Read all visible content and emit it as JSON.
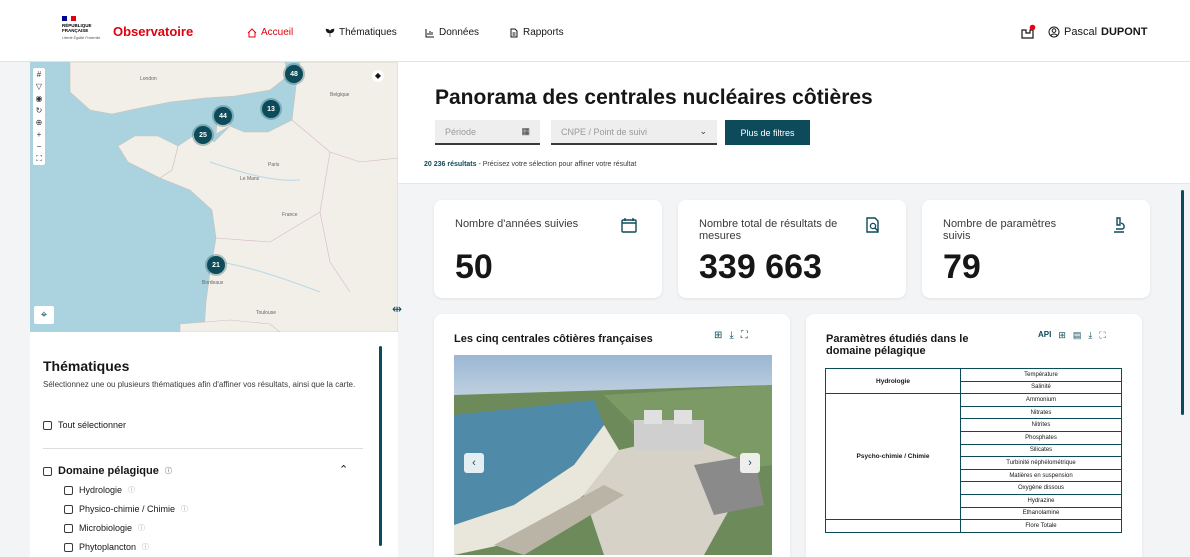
{
  "header": {
    "logo_text_1": "RÉPUBLIQUE",
    "logo_text_2": "FRANÇAISE",
    "logo_motto": "Liberté Égalité Fraternité",
    "brand": "Observatoire",
    "nav": [
      {
        "label": "Accueil",
        "icon": "home-icon",
        "active": true
      },
      {
        "label": "Thématiques",
        "icon": "plant-icon",
        "active": false
      },
      {
        "label": "Données",
        "icon": "chart-icon",
        "active": false
      },
      {
        "label": "Rapports",
        "icon": "document-icon",
        "active": false
      }
    ],
    "notification_icon": "inbox-notification-icon",
    "user_first": "Pascal",
    "user_last": "DUPONT"
  },
  "map": {
    "clusters": [
      {
        "label": "48"
      },
      {
        "label": "13"
      },
      {
        "label": "44"
      },
      {
        "label": "25"
      },
      {
        "label": "21"
      }
    ],
    "place_labels": [
      "London",
      "Belgique",
      "Paris",
      "France",
      "Bordeaux",
      "Toulouse",
      "Le Mans"
    ]
  },
  "thematiques": {
    "title": "Thématiques",
    "description": "Sélectionnez une ou plusieurs thématiques afin d'affiner vos résultats, ainsi que la carte.",
    "select_all": "Tout sélectionner",
    "group": "Domaine pélagique",
    "items": [
      "Hydrologie",
      "Physico-chimie / Chimie",
      "Microbiologie",
      "Phytoplancton"
    ]
  },
  "main": {
    "title": "Panorama des centrales nucléaires côtières",
    "period_placeholder": "Période",
    "cnpe_placeholder": "CNPE / Point de suivi",
    "more_filters": "Plus de filtres",
    "result_count": "20 236 résultats",
    "result_hint": " -  Précisez votre sélection pour affiner votre résultat"
  },
  "kpis": [
    {
      "label": "Nombre d'années suivies",
      "value": "50",
      "icon": "calendar-icon"
    },
    {
      "label": "Nombre total de résultats de mesures",
      "value": "339 663",
      "icon": "search-document-icon"
    },
    {
      "label": "Nombre de paramètres suivis",
      "value": "79",
      "icon": "microscope-icon"
    }
  ],
  "photo_card": {
    "title": "Les cinq centrales côtières françaises"
  },
  "params_card": {
    "title_line1": "Paramètres étudiés dans le",
    "title_line2": "domaine pélagique",
    "api_label": "API",
    "groups": [
      {
        "name": "Hydrologie",
        "params": [
          "Température",
          "Salinité"
        ]
      },
      {
        "name": "Psycho-chimie / Chimie",
        "params": [
          "Ammonium",
          "Nitrates",
          "Nitrites",
          "Phosphates",
          "Silicates",
          "Turbinité néphélométrique",
          "Matières en suspension",
          "Oxygène dissous",
          "Hydrazine",
          "Ethanolamine"
        ]
      },
      {
        "name": "",
        "params": [
          "Flore Totale"
        ]
      }
    ]
  },
  "colors": {
    "primary": "#0d4b5a",
    "accent": "#e1000f",
    "sea": "#aad3df",
    "land": "#f2efe9"
  }
}
